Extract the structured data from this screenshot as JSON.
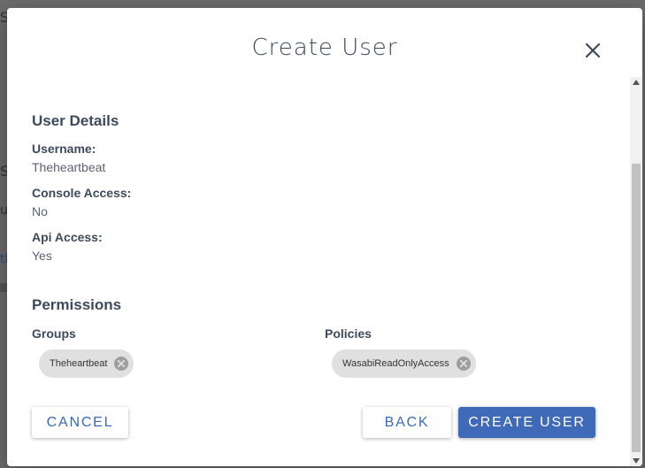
{
  "background": {
    "fragments": [
      "S",
      "S",
      "u",
      "th"
    ]
  },
  "dialog": {
    "title": "Create User",
    "close_icon": "close-icon"
  },
  "user_details": {
    "heading": "User Details",
    "username_label": "Username:",
    "username_value": "Theheartbeat",
    "console_label": "Console Access:",
    "console_value": "No",
    "api_label": "Api Access:",
    "api_value": "Yes"
  },
  "permissions": {
    "heading": "Permissions",
    "groups_label": "Groups",
    "groups": [
      "Theheartbeat"
    ],
    "policies_label": "Policies",
    "policies": [
      "WasabiReadOnlyAccess"
    ]
  },
  "actions": {
    "cancel": "Cancel",
    "back": "Back",
    "create": "Create User"
  },
  "colors": {
    "accent": "#3f6ab8",
    "text_dark": "#3d4a5c",
    "chip_bg": "#e0e0e0"
  }
}
